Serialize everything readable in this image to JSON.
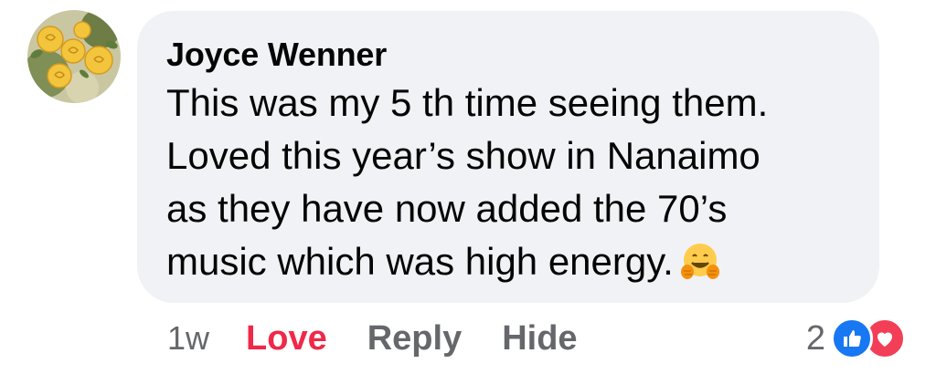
{
  "comment": {
    "author": "Joyce Wenner",
    "lines": [
      "This was my 5 th time seeing them.",
      "Loved this year’s show in Nanaimo",
      "as they have now added the 70’s",
      "music which was high energy."
    ],
    "emoji": "hugging-face-emoji"
  },
  "actions": {
    "time": "1w",
    "love": "Love",
    "reply": "Reply",
    "hide": "Hide"
  },
  "reactions": {
    "count": "2",
    "types": [
      "like",
      "love"
    ],
    "colors": {
      "like": "#1877f2",
      "love": "#f33e58",
      "love_label": "#f02849"
    }
  }
}
